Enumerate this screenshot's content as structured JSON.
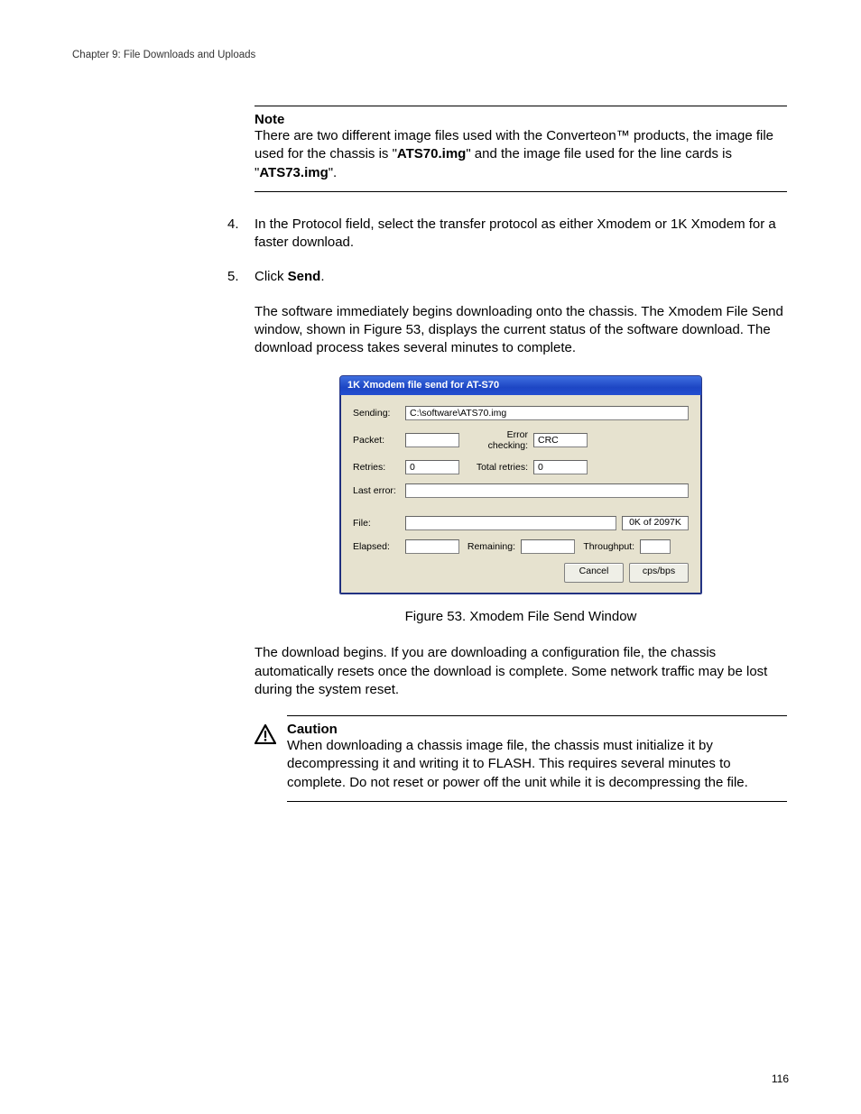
{
  "chapter": "Chapter 9: File Downloads and Uploads",
  "note": {
    "title": "Note",
    "body_pre": "There are two different image files used with the Converteon™ products, the image file used for the chassis is \"",
    "file1": "ATS70.img",
    "body_mid": "\" and the image file used for the line cards is \"",
    "file2": "ATS73.img",
    "body_post": "\"."
  },
  "step4": {
    "num": "4.",
    "text": "In the Protocol field, select the transfer protocol as either Xmodem or 1K Xmodem for a faster download."
  },
  "step5": {
    "num": "5.",
    "text_pre": "Click ",
    "bold": "Send",
    "text_post": "."
  },
  "para1": "The software immediately begins downloading onto the chassis. The Xmodem File Send window, shown in Figure 53, displays the current status of the software download. The download process takes several minutes to complete.",
  "xmodem": {
    "title": "1K Xmodem file send for AT-S70",
    "sending_label": "Sending:",
    "sending_value": "C:\\software\\ATS70.img",
    "packet_label": "Packet:",
    "packet_value": "",
    "error_checking_label": "Error checking:",
    "error_checking_value": "CRC",
    "retries_label": "Retries:",
    "retries_value": "0",
    "total_retries_label": "Total retries:",
    "total_retries_value": "0",
    "last_error_label": "Last error:",
    "last_error_value": "",
    "file_label": "File:",
    "file_status": "0K of 2097K",
    "elapsed_label": "Elapsed:",
    "elapsed_value": "",
    "remaining_label": "Remaining:",
    "remaining_value": "",
    "throughput_label": "Throughput:",
    "throughput_value": "",
    "cancel": "Cancel",
    "cpsbps": "cps/bps"
  },
  "figure_caption": "Figure 53. Xmodem File Send Window",
  "para2": "The download begins. If you are downloading a configuration file, the chassis automatically resets once the download is complete. Some network traffic may be lost during the system reset.",
  "caution": {
    "title": "Caution",
    "body": "When downloading a chassis image file, the chassis must initialize it by decompressing it and writing it to FLASH. This requires several minutes to complete. Do not reset or power off the unit while it is decompressing the file."
  },
  "page_number": "116"
}
